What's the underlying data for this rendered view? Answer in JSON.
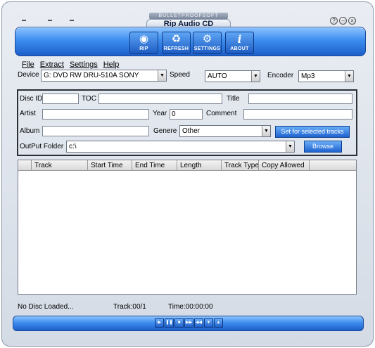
{
  "window": {
    "brand": "BULLETPROOFSOFT",
    "title": "Rip Audio CD",
    "help_glyph": "?",
    "minimize_glyph": "–",
    "close_glyph": "×"
  },
  "toolbar": {
    "rip_label": "RIP",
    "refresh_label": "REFRESH",
    "settings_label": "SETTINGS",
    "about_label": "ABOUT"
  },
  "menu": [
    "File",
    "Extract",
    "Settings",
    "Help"
  ],
  "device": {
    "label": "Device",
    "value": "G: DVD RW DRU-510A  SONY",
    "speed_label": "Speed",
    "speed_value": "AUTO",
    "encoder_label": "Encoder",
    "encoder_value": "Mp3"
  },
  "disc": {
    "disc_id_label": "Disc ID",
    "disc_id_value": "",
    "toc_label": "TOC",
    "toc_value": "",
    "title_label": "Title",
    "title_value": "",
    "artist_label": "Artist",
    "artist_value": "",
    "year_label": "Year",
    "year_value": "0",
    "comment_label": "Comment",
    "comment_value": "",
    "album_label": "Album",
    "album_value": "",
    "genre_label": "Genere",
    "genre_value": "Other",
    "set_tracks_label": "Set for selected tracks",
    "output_label": "OutPut Folder",
    "output_value": "c:\\",
    "browse_label": "Browse"
  },
  "track_list": {
    "columns": [
      "Track",
      "Start Time",
      "End Time",
      "Length",
      "Track Type",
      "Copy Allowed"
    ],
    "rows": []
  },
  "status": {
    "disc_status": "No Disc Loaded...",
    "track": "Track:00/1",
    "time": "Time:00:00:00"
  },
  "transport": [
    "▶",
    "❚❚",
    "■",
    "▶▶",
    "◀◀",
    "▼",
    "▲"
  ],
  "colors": {
    "accent_blue": "#2f7fe6",
    "frame_bg": "#dde3ec"
  }
}
